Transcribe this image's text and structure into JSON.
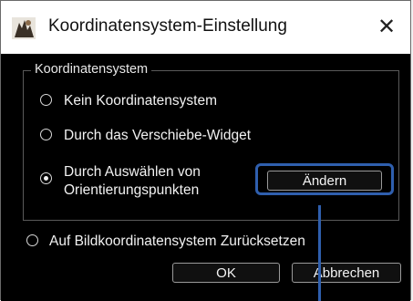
{
  "window": {
    "title": "Koordinatensystem-Einstellung",
    "close_symbol": "✕"
  },
  "group": {
    "title": "Koordinatensystem",
    "options": [
      {
        "label": "Kein Koordinatensystem",
        "checked": false
      },
      {
        "label": "Durch das Verschiebe-Widget",
        "checked": false
      },
      {
        "label_line1": "Durch Auswählen von",
        "label_line2": "Orientierungspunkten",
        "checked": true
      }
    ],
    "change_button": "Ändern"
  },
  "reset_option": {
    "label": "Auf Bildkoordinatensystem Zurücksetzen",
    "checked": false
  },
  "footer": {
    "ok_label": "OK",
    "cancel_label": "Abbrechen"
  },
  "annotation": {
    "color": "#2f5fae"
  }
}
